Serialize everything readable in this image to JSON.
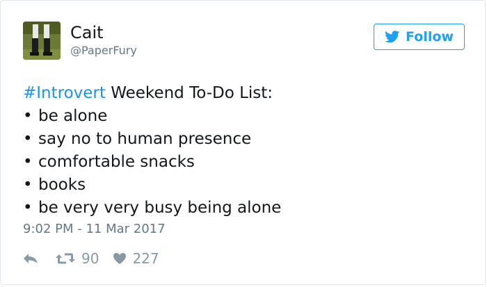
{
  "user": {
    "display_name": "Cait",
    "handle": "@PaperFury"
  },
  "follow_button": {
    "label": "Follow"
  },
  "tweet": {
    "hashtag": "#Introvert",
    "heading_rest": " Weekend To-Do List:",
    "bullet_char": "•",
    "items": [
      "be alone",
      "say no to human presence",
      "comfortable snacks",
      "books",
      "be very very busy being alone"
    ],
    "timestamp": "9:02 PM - 11 Mar 2017"
  },
  "stats": {
    "retweets": "90",
    "likes": "227"
  },
  "colors": {
    "accent": "#1da1f2",
    "hashtag": "#1b95e0",
    "muted": "#657786",
    "icon": "#8899a6"
  },
  "icons": {
    "follow": "twitter-bird-icon",
    "reply": "reply-icon",
    "retweet": "retweet-icon",
    "like": "heart-icon"
  }
}
